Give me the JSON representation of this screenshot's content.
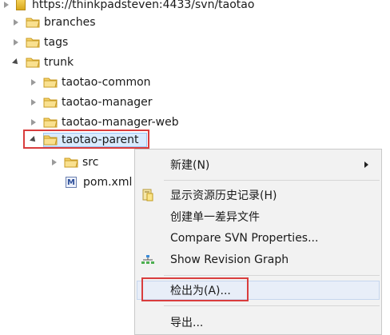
{
  "tree": {
    "repo_url": "https://thinkpadsteven:4433/svn/taotao",
    "branches": "branches",
    "tags": "tags",
    "trunk": "trunk",
    "common": "taotao-common",
    "manager": "taotao-manager",
    "manager_web": "taotao-manager-web",
    "parent": "taotao-parent",
    "src": "src",
    "pom": "pom.xml",
    "pom_badge": "M"
  },
  "menu": {
    "new": "新建(N)",
    "show_history": "显示资源历史记录(H)",
    "create_patch": "创建单一差异文件",
    "compare_props": "Compare SVN Properties...",
    "revision_graph": "Show Revision Graph",
    "checkout_as": "检出为(A)...",
    "export": "导出..."
  },
  "colors": {
    "highlight_border": "#d93d3d",
    "selection_bg": "#d9ebff",
    "folder_yellow": "#f0c040"
  }
}
